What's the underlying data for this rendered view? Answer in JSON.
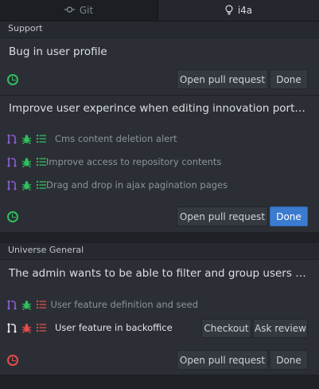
{
  "tabs": [
    {
      "label": "Git",
      "icon": "git-commit-icon",
      "active": false
    },
    {
      "label": "i4a",
      "icon": "lightbulb-icon",
      "active": true
    }
  ],
  "colors": {
    "green": "#2fbf5d",
    "red": "#e64c4c",
    "purple": "#8e5ad6",
    "primary": "#3b7bd0"
  },
  "groups": [
    {
      "name": "Support",
      "issues": [
        {
          "title": "Bug in user profile",
          "status_icon": "clock-green-icon",
          "actions": [
            "Open pull request",
            "Done"
          ],
          "tasks": []
        },
        {
          "title": "Improve user experince when editing innovation portal ite...",
          "status_icon": "clock-green-icon",
          "actions": [
            "Open pull request",
            "Done"
          ],
          "tasks": [
            {
              "label": "Cms content deletion alert"
            },
            {
              "label": "Improve access to repository contents"
            },
            {
              "label": "Drag and drop in ajax pagination pages"
            }
          ]
        }
      ]
    },
    {
      "name": "Universe General",
      "issues": [
        {
          "title": "The admin wants to be able to filter and group users by fe...",
          "status_icon": "clock-red-icon",
          "actions": [
            "Open pull request",
            "Done"
          ],
          "tasks": [
            {
              "label": "User feature definition and seed"
            },
            {
              "label": "User feature in backoffice",
              "actions": [
                "Checkout",
                "Ask review"
              ]
            }
          ]
        }
      ]
    }
  ]
}
